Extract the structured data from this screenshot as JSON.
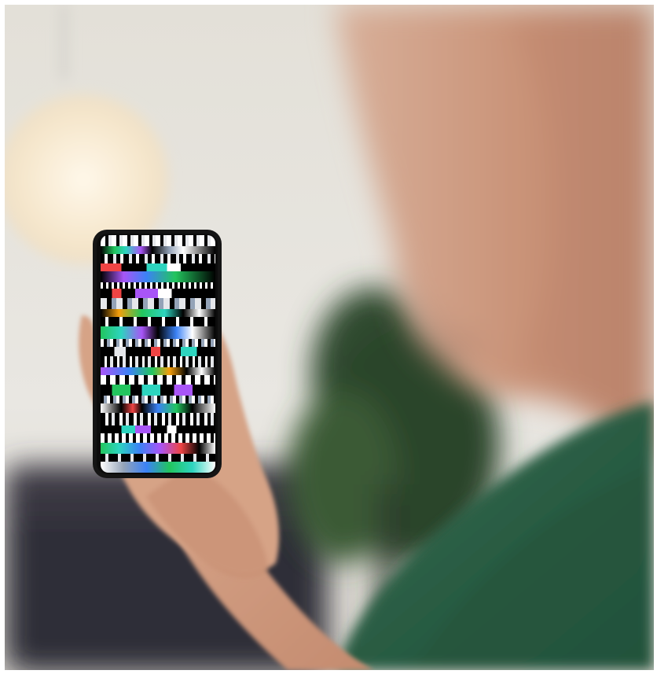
{
  "scene": {
    "subject": "photo-glitched-phone-screen",
    "palette": {
      "wall": "#e9e7e2",
      "wall_shadow": "#d8d6d1",
      "lamp": "#fbf1df",
      "sofa": "#3a3843",
      "plant": "#2f4a2f",
      "skin": "#d8a78a",
      "skin_shadow": "#b98468",
      "shirt": "#2f6a4d",
      "shirt_dark": "#24533d",
      "phone": "#151515"
    },
    "glitch_colors": [
      "#ffffff",
      "#000000",
      "#2dd4bf",
      "#a855f7",
      "#22c55e",
      "#ef4444",
      "#3b82f6",
      "#f59e0b",
      "#94a3b8",
      "#e5e7eb"
    ]
  }
}
